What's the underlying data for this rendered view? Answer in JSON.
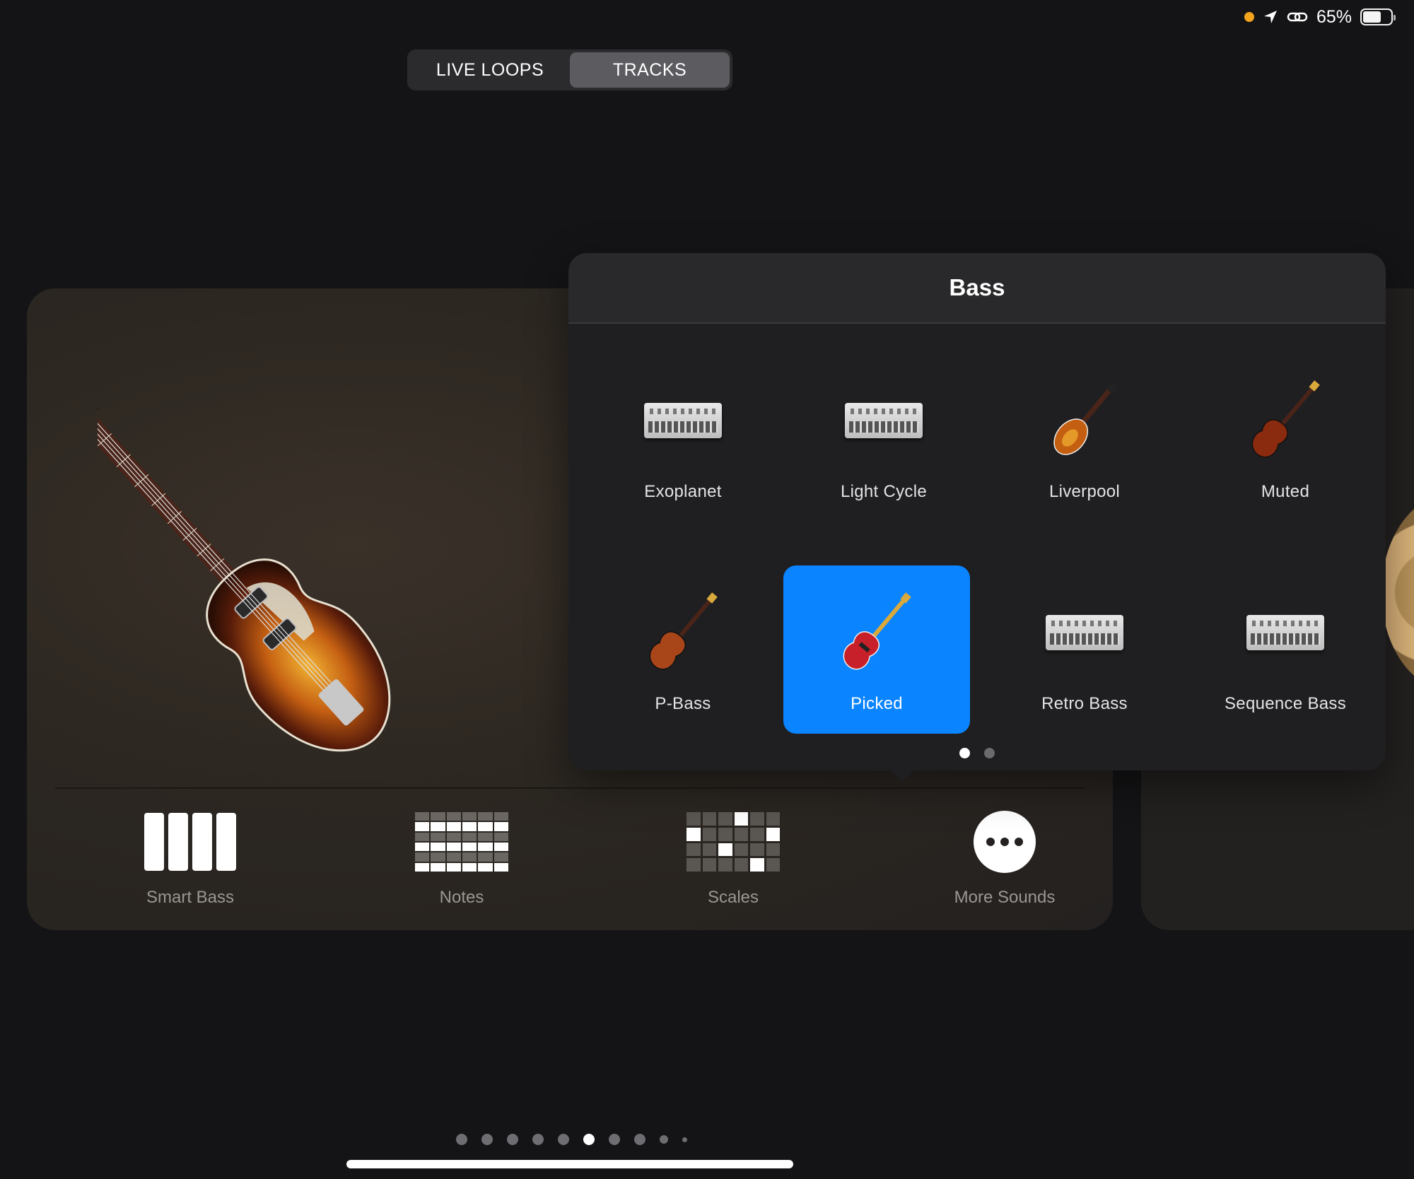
{
  "status": {
    "battery_percent": "65%",
    "battery_level": 0.65,
    "icons": [
      "recording-dot-icon",
      "location-icon",
      "link-icon",
      "battery-icon"
    ]
  },
  "mode_switch": {
    "options": [
      {
        "label": "LIVE LOOPS",
        "active": false
      },
      {
        "label": "TRACKS",
        "active": true
      }
    ]
  },
  "instrument": {
    "tools": [
      {
        "label": "Smart Bass",
        "icon": "smart-bass-strings-icon"
      },
      {
        "label": "Notes",
        "icon": "notes-fretboard-icon"
      },
      {
        "label": "Scales",
        "icon": "scales-grid-icon"
      },
      {
        "label": "More Sounds",
        "icon": "more-ellipsis-icon"
      }
    ]
  },
  "sound_picker": {
    "title": "Bass",
    "items": [
      {
        "label": "Exoplanet",
        "thumb": "drum-machine",
        "selected": false
      },
      {
        "label": "Light Cycle",
        "thumb": "drum-machine",
        "selected": false
      },
      {
        "label": "Liverpool",
        "thumb": "violin-bass",
        "selected": false
      },
      {
        "label": "Muted",
        "thumb": "sunburst-bass",
        "selected": false
      },
      {
        "label": "P-Bass",
        "thumb": "sunburst-bass",
        "selected": false
      },
      {
        "label": "Picked",
        "thumb": "red-bass",
        "selected": true
      },
      {
        "label": "Retro Bass",
        "thumb": "drum-machine",
        "selected": false
      },
      {
        "label": "Sequence Bass",
        "thumb": "drum-machine",
        "selected": false
      }
    ],
    "page_count": 2,
    "current_page": 1,
    "selected_color": "#0a84ff"
  },
  "instrument_pages": {
    "count": 10,
    "current": 6
  }
}
